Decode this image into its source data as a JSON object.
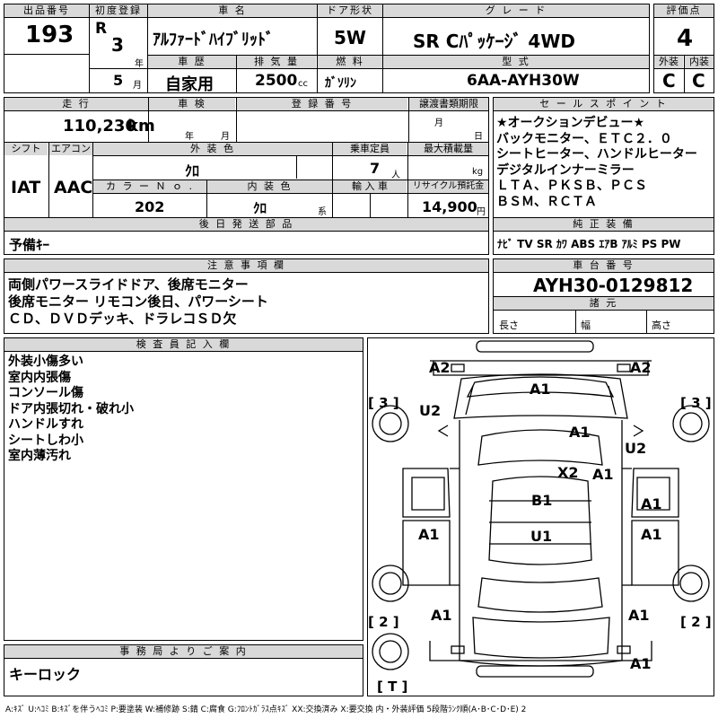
{
  "header": {
    "lot_label": "出品番号",
    "lot_no": "193",
    "first_reg_label": "初度登録",
    "era": "R",
    "year": "3",
    "year_unit": "年",
    "month": "5",
    "month_unit": "月",
    "car_name_label": "車 名",
    "car_name": "ｱﾙﾌｧｰﾄﾞﾊｲﾌﾞﾘｯﾄﾞ",
    "door_label": "ドア形状",
    "door": "5W",
    "grade_label": "グ レ ー ド",
    "grade": "SR Cﾊﾟｯｹｰｼﾞ 4WD",
    "score_label": "評価点",
    "score": "4",
    "history_label": "車 歴",
    "history": "自家用",
    "displacement_label": "排 気 量",
    "displacement": "2500",
    "displacement_unit": "cc",
    "fuel_label": "燃 料",
    "fuel": "ｶﾞｿﾘﾝ",
    "model_label": "型 式",
    "model": "6AA-AYH30W",
    "exterior_label": "外装",
    "exterior": "C",
    "interior_label": "内装",
    "interior": "C"
  },
  "row2": {
    "mileage_label": "走 行",
    "mileage": "110,230",
    "mileage_unit": "km",
    "inspection_label": "車 検",
    "insp_year_unit": "年",
    "insp_month_unit": "月",
    "reg_no_label": "登 録 番 号",
    "transfer_label": "譲渡書類期限",
    "transfer_month_unit": "月",
    "transfer_day_unit": "日",
    "shift_label": "シフト",
    "shift": "IAT",
    "aircon_label": "エアコン",
    "aircon": "AAC",
    "color_label": "外 装 色",
    "color": "ｸﾛ",
    "capacity_label": "乗車定員",
    "capacity": "7",
    "capacity_unit": "人",
    "load_label": "最大積載量",
    "load_unit": "kg",
    "color_no_label": "カ ラ ー Ｎ ｏ .",
    "color_no": "202",
    "int_color_label": "内 装 色",
    "int_color": "ｸﾛ",
    "int_color_unit": "系",
    "import_label": "輸 入 車",
    "recycle_label": "リサイクル預託金",
    "recycle": "14,900",
    "recycle_unit": "円",
    "later_label": "後 日 発 送 部 品",
    "later": "予備ｷｰ"
  },
  "sales_point": {
    "label": "セ ー ル ス ポ イ ン ト",
    "lines": [
      "★オークションデビュー★",
      "バックモニター、ＥＴＣ２．０",
      "シートヒーター、ハンドルヒーター",
      "デジタルインナーミラー",
      "ＬＴＡ、ＰＫＳＢ、ＰＣＳ",
      "ＢＳＭ、ＲＣＴＡ"
    ]
  },
  "equipment": {
    "label": "純 正 装 備",
    "items": "ﾅﾋﾞ TV SR ｶﾜ ABS ｴｱB ｱﾙﾐ PS PW"
  },
  "notes": {
    "label": "注 意 事 項 欄",
    "lines": [
      "両側パワースライドドア、後席モニター",
      "後席モニター リモコン後日、パワーシート",
      "ＣＤ、ＤＶＤデッキ、ドラレコＳＤ欠"
    ]
  },
  "chassis": {
    "label": "車 台 番 号",
    "number": "AYH30-0129812",
    "spec_label": "諸 元",
    "length_label": "長さ",
    "width_label": "幅",
    "height_label": "高さ"
  },
  "inspector": {
    "label": "検 査 員 記 入 欄",
    "lines": [
      "外装小傷多い",
      "室内内張傷",
      "コンソール傷",
      "ドア内張切れ・破れ小",
      "ハンドルすれ",
      "シートしわ小",
      "室内薄汚れ"
    ]
  },
  "office": {
    "label": "事 務 局 よ り ご 案 内",
    "text": "キーロック"
  },
  "legend": "A:ｷｽﾞ U:ﾍｺﾐ B:ｷｽﾞを伴うﾍｺﾐ P:要塗装 W:補修跡 S:錆 C:腐食 G:ﾌﾛﾝﾄｶﾞﾗｽ点ｷｽﾞ XX:交換済み X:要交換 内・外装評価 5段階ﾗﾝｸ順(A･B･C･D･E) 2",
  "diagram": {
    "brackets": [
      "[ 3 ]",
      "[ 3 ]",
      "[ 2 ]",
      "[ 2 ]",
      "[ T ]"
    ],
    "marks": [
      "A2",
      "A2",
      "A1",
      "U2",
      "A1",
      "U2",
      "X2",
      "A1",
      "B1",
      "A1",
      "A1",
      "U1",
      "A1",
      "A1",
      "A1",
      "A1"
    ]
  }
}
